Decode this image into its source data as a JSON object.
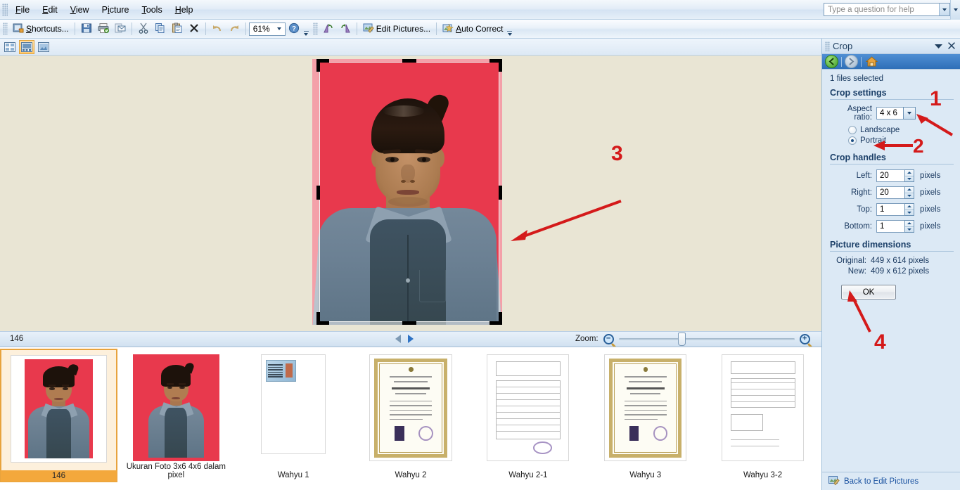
{
  "window": {
    "help_placeholder": "Type a question for help"
  },
  "menubar": {
    "items": [
      {
        "label": "File"
      },
      {
        "label": "Edit"
      },
      {
        "label": "View"
      },
      {
        "label": "Picture"
      },
      {
        "label": "Tools"
      },
      {
        "label": "Help"
      }
    ]
  },
  "toolbar": {
    "shortcuts_label": "Shortcuts...",
    "zoom_value": "61%",
    "edit_pictures_label": "Edit Pictures...",
    "auto_correct_label": "Auto Correct",
    "icons": {
      "shortcuts": "shortcuts-icon",
      "save": "save-icon",
      "print": "print-icon",
      "email": "email-icon",
      "cut": "cut-icon",
      "copy": "copy-icon",
      "paste": "paste-icon",
      "delete": "delete-icon",
      "undo": "undo-icon",
      "redo": "redo-icon",
      "help": "help-icon",
      "rotate_left": "rotate-left-icon",
      "rotate_right": "rotate-right-icon"
    }
  },
  "viewbar": {
    "buttons": [
      {
        "name": "thumbnail-view",
        "active": false
      },
      {
        "name": "filmstrip-view",
        "active": true
      },
      {
        "name": "single-picture-view",
        "active": false
      }
    ]
  },
  "statusbar": {
    "file_name": "146",
    "zoom_label": "Zoom:"
  },
  "annotations": [
    {
      "number": "1",
      "target": "aspect-ratio-dropdown"
    },
    {
      "number": "2",
      "target": "portrait-radio"
    },
    {
      "number": "3",
      "target": "crop-right-handle"
    },
    {
      "number": "4",
      "target": "ok-button"
    }
  ],
  "filmstrip": {
    "thumbnails": [
      {
        "label": "146",
        "kind": "portrait",
        "selected": true
      },
      {
        "label": "Ukuran Foto 3x6 4x6 dalam pixel",
        "kind": "portrait",
        "selected": false
      },
      {
        "label": "Wahyu 1",
        "kind": "idcard",
        "selected": false
      },
      {
        "label": "Wahyu 2",
        "kind": "certificate",
        "selected": false
      },
      {
        "label": "Wahyu 2-1",
        "kind": "table",
        "selected": false
      },
      {
        "label": "Wahyu 3",
        "kind": "certificate",
        "selected": false
      },
      {
        "label": "Wahyu 3-2",
        "kind": "table",
        "selected": false
      }
    ]
  },
  "pane": {
    "title": "Crop",
    "files_selected": "1 files selected",
    "crop_settings": {
      "section_title": "Crop settings",
      "aspect_ratio_label": "Aspect ratio:",
      "aspect_ratio_value": "4 x 6",
      "orientation": [
        {
          "label": "Landscape",
          "checked": false
        },
        {
          "label": "Portrait",
          "checked": true
        }
      ]
    },
    "crop_handles": {
      "section_title": "Crop handles",
      "units": "pixels",
      "fields": [
        {
          "label": "Left:",
          "value": "20"
        },
        {
          "label": "Right:",
          "value": "20"
        },
        {
          "label": "Top:",
          "value": "1"
        },
        {
          "label": "Bottom:",
          "value": "1"
        }
      ]
    },
    "picture_dimensions": {
      "section_title": "Picture dimensions",
      "original_label": "Original:",
      "original_value": "449 x 614 pixels",
      "new_label": "New:",
      "new_value": "409 x 612 pixels"
    },
    "ok_label": "OK",
    "footer_link": "Back to Edit Pictures"
  },
  "colors": {
    "accent_blue": "#2e6fb8",
    "pane_bg": "#dce9f5",
    "canvas_bg": "#e9e5d4",
    "annotation_red": "#d41a1a",
    "selection_orange": "#f3a83c",
    "photo_background": "#e8394d"
  }
}
